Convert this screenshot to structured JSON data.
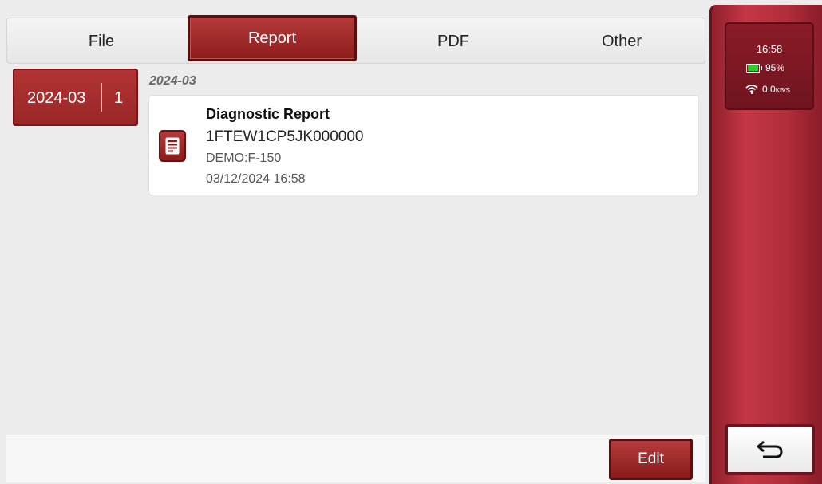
{
  "tabs": [
    {
      "label": "File",
      "active": false
    },
    {
      "label": "Report",
      "active": true
    },
    {
      "label": "PDF",
      "active": false
    },
    {
      "label": "Other",
      "active": false
    }
  ],
  "month_list": [
    {
      "month": "2024-03",
      "count": "1"
    }
  ],
  "section_title": "2024-03",
  "reports": [
    {
      "title": "Diagnostic Report",
      "vin": "1FTEW1CP5JK000000",
      "model": "DEMO:F-150",
      "datetime": "03/12/2024 16:58",
      "icon": "report-document-icon"
    }
  ],
  "bottom_bar": {
    "edit_label": "Edit"
  },
  "status": {
    "time": "16:58",
    "battery": "95%",
    "network_speed": "0.0",
    "network_unit": "KB/S"
  },
  "side_panel": {
    "back_icon": "return-arrow-icon"
  },
  "colors": {
    "accent": "#9e2a2a",
    "side_panel": "#b02d3a",
    "battery": "#2bd12b"
  }
}
